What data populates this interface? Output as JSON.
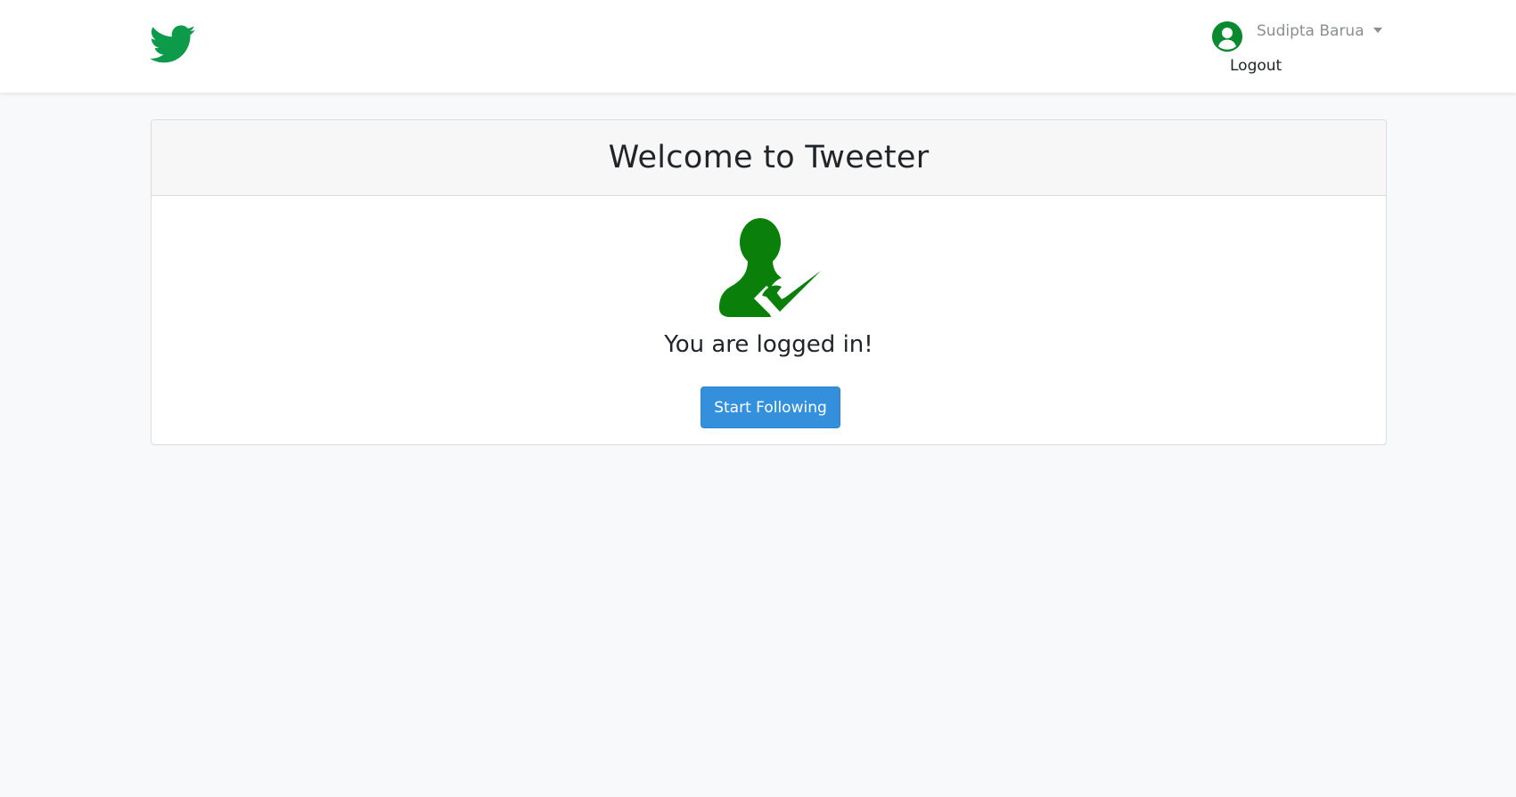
{
  "brand": {
    "icon": "twitter-bird-icon",
    "color": "#0d9a4b"
  },
  "user_menu": {
    "username": "Sudipta Barua",
    "avatar_icon": "user-avatar-icon",
    "logout_label": "Logout"
  },
  "card": {
    "title": "Welcome to Tweeter",
    "icon": "user-check-icon",
    "icon_color": "#0a7f0a",
    "message": "You are logged in!",
    "button_label": "Start Following",
    "button_color": "#3490dc"
  }
}
